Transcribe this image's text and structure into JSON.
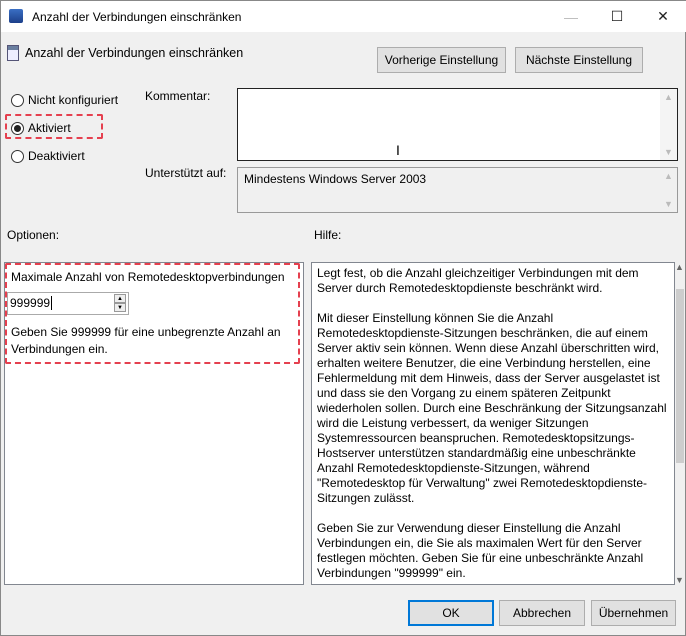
{
  "window": {
    "title": "Anzahl der Verbindungen einschränken",
    "minimize": "—",
    "maximize": "☐",
    "close": "✕"
  },
  "header": {
    "title": "Anzahl der Verbindungen einschränken",
    "prev_button": "Vorherige Einstellung",
    "next_button": "Nächste Einstellung"
  },
  "state": {
    "options": [
      {
        "label": "Nicht konfiguriert",
        "selected": false
      },
      {
        "label": "Aktiviert",
        "selected": true
      },
      {
        "label": "Deaktiviert",
        "selected": false
      }
    ]
  },
  "comment": {
    "label": "Kommentar:",
    "value": ""
  },
  "supported": {
    "label": "Unterstützt auf:",
    "value": "Mindestens Windows Server 2003"
  },
  "options_label": "Optionen:",
  "help_label": "Hilfe:",
  "options": {
    "field_label": "Maximale Anzahl von Remotedesktopverbindungen",
    "value": "999999",
    "description": "Geben Sie 999999 für eine unbegrenzte Anzahl an Verbindungen ein."
  },
  "help": {
    "paragraphs": [
      "Legt fest, ob die Anzahl gleichzeitiger Verbindungen mit dem Server durch Remotedesktopdienste beschränkt wird.",
      "Mit dieser Einstellung können Sie die Anzahl Remotedesktopdienste-Sitzungen beschränken, die auf einem Server aktiv sein können. Wenn diese Anzahl überschritten wird, erhalten weitere Benutzer, die eine Verbindung herstellen, eine Fehlermeldung mit dem Hinweis, dass der Server ausgelastet ist und dass sie den Vorgang zu einem späteren Zeitpunkt wiederholen sollen. Durch eine Beschränkung der Sitzungsanzahl wird die Leistung verbessert, da weniger Sitzungen Systemressourcen beanspruchen. Remotedesktopsitzungs-Hostserver unterstützen standardmäßig eine unbeschränkte Anzahl Remotedesktopdienste-Sitzungen, während \"Remotedesktop für Verwaltung\" zwei Remotedesktopdienste-Sitzungen zulässt.",
      "Geben Sie zur Verwendung dieser Einstellung die Anzahl Verbindungen ein, die Sie als maximalen Wert für den Server festlegen möchten. Geben Sie für eine unbeschränkte Anzahl Verbindungen \"999999\" ein."
    ]
  },
  "footer": {
    "ok": "OK",
    "cancel": "Abbrechen",
    "apply": "Übernehmen"
  }
}
